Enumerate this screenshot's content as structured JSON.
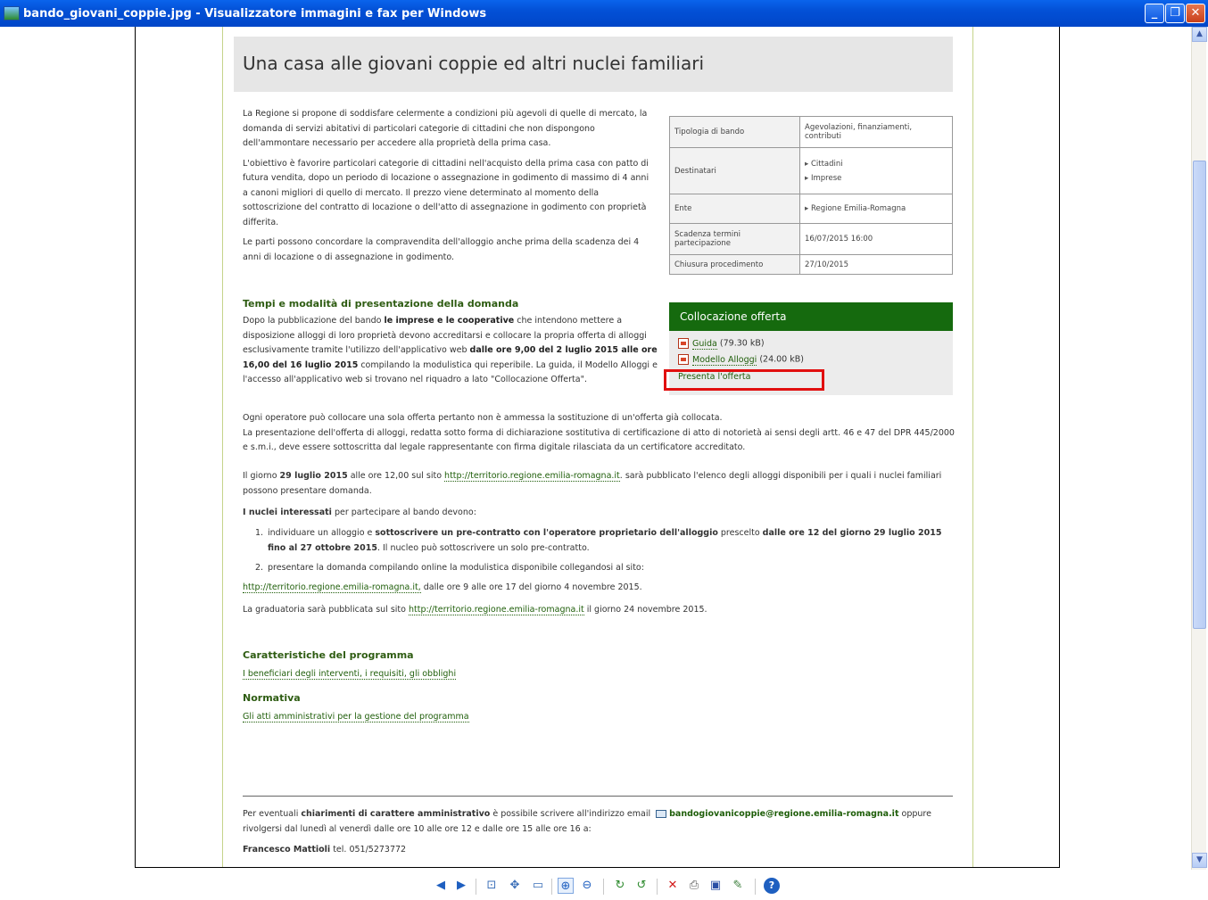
{
  "window": {
    "title": "bando_giovani_coppie.jpg - Visualizzatore immagini e fax per Windows",
    "min_glyph": "_",
    "restore_glyph": "❐",
    "close_glyph": "✕"
  },
  "scrollbar": {
    "up_glyph": "▲",
    "down_glyph": "▼"
  },
  "page": {
    "heading": "Una casa alle giovani coppie ed altri nuclei familiari",
    "intro": [
      "La Regione si propone di soddisfare celermente a condizioni più agevoli di quelle di mercato, la domanda di servizi abitativi di particolari categorie di cittadini che non dispongono dell'ammontare necessario per accedere alla proprietà della prima casa.",
      "L'obiettivo è favorire particolari categorie di cittadini nell'acquisto della prima casa con patto di futura vendita, dopo un periodo di locazione o assegnazione in godimento di massimo di 4 anni a canoni migliori di quello di mercato. Il prezzo viene determinato al momento della sottoscrizione del contratto di locazione o dell'atto di assegnazione in godimento con proprietà differita.",
      "Le parti possono concordare la compravendita dell'alloggio anche prima della scadenza dei 4 anni di locazione o di assegnazione in godimento."
    ],
    "info_table": {
      "tipologia_label": "Tipologia di bando",
      "tipologia_value": "Agevolazioni, finanziamenti, contributi",
      "destinatari_label": "Destinatari",
      "destinatari_1": "Cittadini",
      "destinatari_2": "Imprese",
      "ente_label": "Ente",
      "ente_value": "Regione Emilia-Romagna",
      "scadenza_label": "Scadenza termini partecipazione",
      "scadenza_value": "16/07/2015 16:00",
      "chiusura_label": "Chiusura procedimento",
      "chiusura_value": "27/10/2015"
    },
    "tempi": {
      "title": "Tempi e modalità di presentazione della domanda",
      "t1": "Dopo la pubblicazione del bando ",
      "b1": "le imprese e le cooperative",
      "t2": " che intendono mettere a disposizione alloggi di loro proprietà devono accreditarsi e collocare la propria offerta di alloggi esclusivamente tramite l'utilizzo dell'applicativo web ",
      "b2": "dalle ore 9,00 del 2 luglio 2015 alle ore 16,00 del 16 luglio 2015",
      "t3": " compilando la modulistica qui reperibile. La guida, il Modello Alloggi e l'accesso all'applicativo web si trovano nel riquadro a lato \"Collocazione Offerta\"."
    },
    "offer": {
      "title": "Collocazione offerta",
      "guida_label": "Guida",
      "guida_size": "(79.30 kB)",
      "modello_label": "Modello Alloggi",
      "modello_size": "(24.00 kB)",
      "presenta_label": "Presenta l'offerta"
    },
    "para_operatore": "Ogni operatore può collocare una sola offerta pertanto non è ammessa la sostituzione di un'offerta già collocata.",
    "para_presentazione": "La presentazione dell'offerta di alloggi, redatta sotto forma di dichiarazione sostitutiva di certificazione di atto di notorietà ai sensi degli artt. 46 e 47 del DPR 445/2000 e s.m.i., deve essere sottoscritta dal legale rappresentante con firma digitale rilasciata da un certificatore accreditato.",
    "giorno": {
      "t1": "Il giorno ",
      "b1": "29 luglio 2015",
      "t2": " alle ore 12,00 sul sito ",
      "link": "http://territorio.regione.emilia-romagna.it",
      "t3": ". sarà pubblicato l'elenco degli alloggi disponibili per i quali i nuclei familiari possono presentare domanda."
    },
    "nuclei": {
      "b1": "I nuclei interessati",
      "t1": " per partecipare al bando devono:"
    },
    "step1": {
      "num": "1.",
      "t1": "individuare un alloggio e ",
      "b1": "sottoscrivere un pre-contratto con l'operatore proprietario dell'alloggio",
      "t2": " prescelto ",
      "b2": "dalle ore 12 del giorno 29 luglio 2015 fino al 27 ottobre 2015",
      "t3": ". Il nucleo può sottoscrivere un solo pre-contratto."
    },
    "step2": {
      "num": "2.",
      "t1": "presentare la domanda compilando online la modulistica disponibile collegandosi al sito:"
    },
    "online": {
      "link": "http://territorio.regione.emilia-romagna.it,",
      "t1": "  dalle ore 9 alle ore 17 del giorno 4 novembre 2015."
    },
    "graduatoria": {
      "t1": "La graduatoria sarà pubblicata sul sito ",
      "link": "http://territorio.regione.emilia-romagna.it",
      "t2": " il giorno 24 novembre 2015."
    },
    "caratteristiche": {
      "title": "Caratteristiche del programma",
      "link": "I beneficiari degli interventi, i requisiti, gli obblighi"
    },
    "normativa": {
      "title": "Normativa",
      "link": "Gli atti amministrativi per la gestione del programma"
    },
    "footer": {
      "t1": "Per eventuali ",
      "b1": "chiarimenti di carattere amministrativo",
      "t2": " è possibile scrivere all'indirizzo email ",
      "email": "bandogiovanicoppie@regione.emilia-romagna.it",
      "t3": " oppure rivolgersi dal lunedì al venerdì dalle ore 10 alle ore 12 e dalle ore 15 alle ore 16 a:",
      "name": "Francesco Mattioli",
      "tel": " tel. 051/5273772"
    }
  },
  "toolbar": {
    "prev_glyph": "◀",
    "next_glyph": "▶",
    "best_fit_glyph": "⊡",
    "actual_size_glyph": "✥",
    "slideshow_glyph": "▭",
    "zoom_in_glyph": "⊕",
    "zoom_out_glyph": "⊖",
    "rotate_cw_glyph": "↻",
    "rotate_ccw_glyph": "↺",
    "delete_glyph": "✕",
    "print_glyph": "⎙",
    "save_glyph": "▣",
    "edit_glyph": "✎",
    "help_glyph": "?"
  },
  "colors": {
    "accent_green": "#156a0e",
    "link_green": "#1f5e0a",
    "highlight_red": "#e10f0f",
    "titlebar_blue": "#0350d6"
  }
}
